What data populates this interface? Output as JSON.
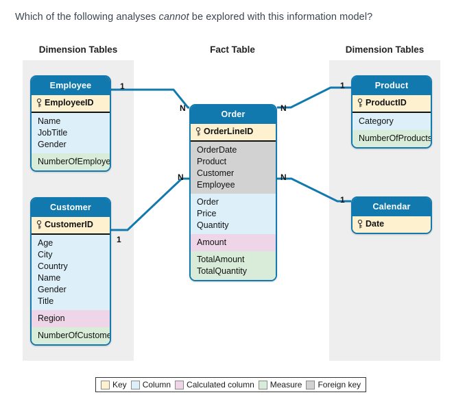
{
  "question": {
    "prefix": "Which of the following analyses ",
    "emphasis": "cannot",
    "suffix": " be explored with this information model?"
  },
  "sections": {
    "left": "Dimension Tables",
    "center": "Fact Table",
    "right": "Dimension Tables"
  },
  "colors": {
    "accent": "#1279ae",
    "key": "#fdf1cf",
    "column": "#ddf0fa",
    "calculated": "#eed6e8",
    "measure": "#d9ecd9",
    "foreign_key": "#d2d2d2",
    "panel": "#eeeeee"
  },
  "tables": {
    "employee": {
      "name": "Employee",
      "key": "EmployeeID",
      "columns": [
        "Name",
        "JobTitle",
        "Gender"
      ],
      "measures": [
        "NumberOfEmployees"
      ]
    },
    "customer": {
      "name": "Customer",
      "key": "CustomerID",
      "columns": [
        "Age",
        "City",
        "Country",
        "Name",
        "Gender",
        "Title"
      ],
      "calculated": [
        "Region"
      ],
      "measures": [
        "NumberOfCustomers"
      ]
    },
    "order": {
      "name": "Order",
      "key": "OrderLineID",
      "foreign_keys": [
        "OrderDate",
        "Product",
        "Customer",
        "Employee"
      ],
      "columns": [
        "Order",
        "Price",
        "Quantity"
      ],
      "calculated": [
        "Amount"
      ],
      "measures": [
        "TotalAmount",
        "TotalQuantity"
      ]
    },
    "product": {
      "name": "Product",
      "key": "ProductID",
      "columns": [
        "Category"
      ],
      "measures": [
        "NumberOfProducts"
      ]
    },
    "calendar": {
      "name": "Calendar",
      "key": "Date"
    }
  },
  "relationships": [
    {
      "id": "employee-order",
      "from": "Employee",
      "to": "Order",
      "from_cardinality": "1",
      "to_cardinality": "N"
    },
    {
      "id": "customer-order",
      "from": "Customer",
      "to": "Order",
      "from_cardinality": "1",
      "to_cardinality": "N"
    },
    {
      "id": "order-product",
      "from": "Order",
      "to": "Product",
      "from_cardinality": "N",
      "to_cardinality": "1"
    },
    {
      "id": "order-calendar",
      "from": "Order",
      "to": "Calendar",
      "from_cardinality": "N",
      "to_cardinality": "1"
    }
  ],
  "legend": [
    {
      "label": "Key",
      "color": "#fdf1cf"
    },
    {
      "label": "Column",
      "color": "#ddf0fa"
    },
    {
      "label": "Calculated column",
      "color": "#eed6e8"
    },
    {
      "label": "Measure",
      "color": "#d9ecd9"
    },
    {
      "label": "Foreign key",
      "color": "#d2d2d2"
    }
  ]
}
